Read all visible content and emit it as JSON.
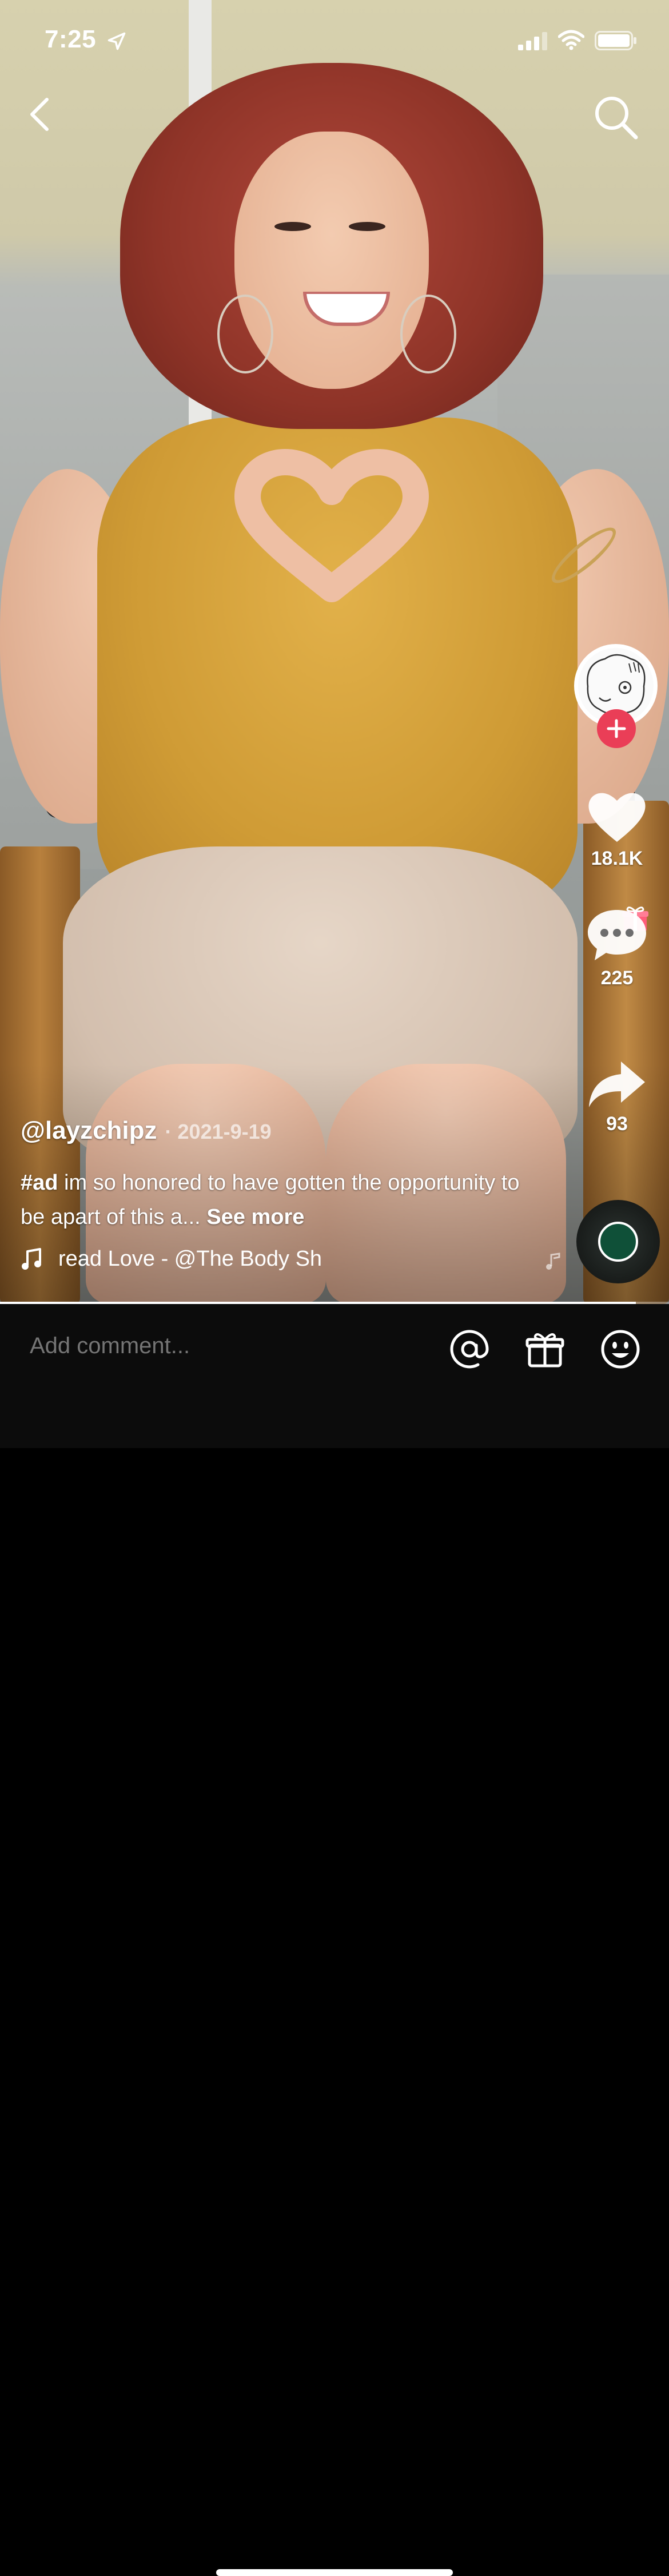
{
  "status_bar": {
    "time": "7:25"
  },
  "video": {
    "progress_fraction": 0.95
  },
  "rail": {
    "likes_count": "18.1K",
    "comments_count": "225",
    "shares_count": "93"
  },
  "post": {
    "username": "@layzchipz",
    "date": "· 2021-9-19",
    "caption_tag": "#ad",
    "caption_text": "im so honored to have gotten the opportunity to be apart of this a...",
    "see_more": "See more",
    "music": "read Love - @The Body Sh"
  },
  "comment_bar": {
    "placeholder": "Add comment..."
  },
  "colors": {
    "follow_button": "#ea3e57",
    "comment_bar_bg": "#0c0c0c"
  }
}
